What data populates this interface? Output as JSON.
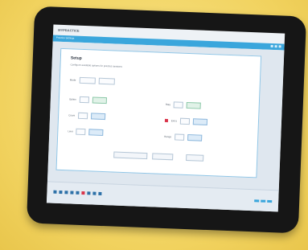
{
  "app": {
    "title": "MYPRACTICE",
    "window_title": "Practice Settings"
  },
  "panel": {
    "heading": "Setup",
    "subtitle": "Configure available options for practice sessions"
  },
  "fields": [
    {
      "label": "Mode"
    },
    {
      "label": "Option"
    },
    {
      "label": "Count"
    },
    {
      "label": "Limit"
    },
    {
      "label": "Rate"
    },
    {
      "label": "Extra"
    },
    {
      "label": "Range"
    }
  ],
  "taskbar": {
    "item_count": 9,
    "active_index": 5
  },
  "colors": {
    "accent": "#3aa6dc",
    "highlight": "#d9344a"
  }
}
